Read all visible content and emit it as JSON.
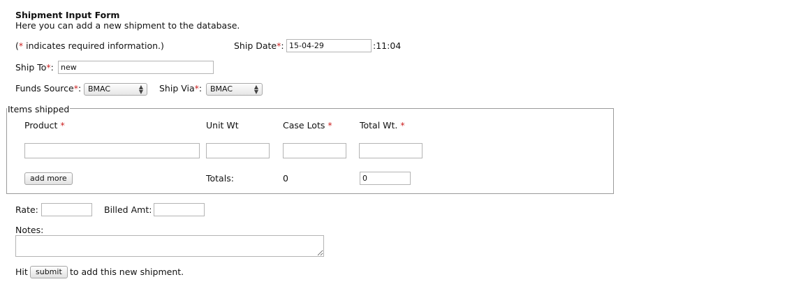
{
  "form": {
    "title": "Shipment Input Form",
    "subtitle": "Here you can add a new shipment to the database.",
    "required_note_pre": "(",
    "required_star": "*",
    "required_note_post": " indicates required information.)"
  },
  "ship_date": {
    "label": "Ship Date",
    "value": "15-04-29",
    "time_suffix": ":11:04"
  },
  "ship_to": {
    "label": "Ship To",
    "value": "new"
  },
  "funds_source": {
    "label": "Funds Source",
    "selected": "BMAC"
  },
  "ship_via": {
    "label": "Ship Via",
    "selected": "BMAC"
  },
  "items": {
    "legend": "Items shipped",
    "columns": {
      "product": "Product",
      "unit_wt": "Unit Wt",
      "case_lots": "Case Lots",
      "total_wt": "Total Wt."
    },
    "add_more_label": "add more",
    "totals_label": "Totals:",
    "case_lots_total": "0",
    "total_wt_total": "0"
  },
  "rate": {
    "label": "Rate:"
  },
  "billed_amt": {
    "label": "Billed Amt:"
  },
  "notes": {
    "label": "Notes:"
  },
  "submit": {
    "pre": "Hit",
    "button_label": "submit",
    "post": "to add this new shipment."
  },
  "colors": {
    "required_star": "#cc2222"
  }
}
